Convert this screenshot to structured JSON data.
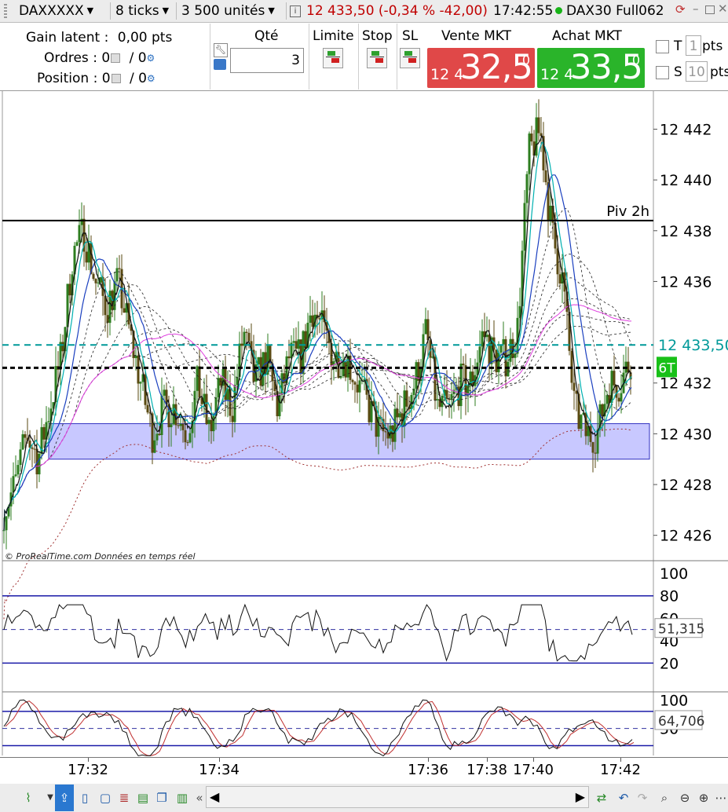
{
  "toolbar": {
    "instrument_select": "DAXXXXX",
    "ticks_select": "8 ticks",
    "units_select": "3 500 unités",
    "quote_text": "12 433,50 (-0,34 % -42,00)",
    "time": "17:42:55",
    "instrument_name": "DAX30 Full062",
    "colors": {
      "quote": "#c00000",
      "live_dot": "#18b418"
    }
  },
  "order_panel": {
    "gain_label": "Gain latent :",
    "gain_value": "0,00 pts",
    "orders_label": "Ordres : 0",
    "orders_value": "/ 0",
    "position_label": "Position : 0",
    "position_value": "/ 0",
    "qty_label": "Qté",
    "qty_value": "3",
    "limit_label": "Limite",
    "stop_label": "Stop",
    "sl_label": "SL",
    "sell_label": "Vente MKT",
    "sell_prefix": "12 4",
    "sell_big": "32,5",
    "sell_sup": "0",
    "buy_label": "Achat MKT",
    "buy_prefix": "12 4",
    "buy_big": "33,5",
    "buy_sup": "0",
    "t_label": "T",
    "t_value": "1",
    "t_unit": "pts",
    "s_label": "S",
    "s_value": "10",
    "s_unit": "pts",
    "colors": {
      "sell": "#e04848",
      "buy": "#2ab42a"
    }
  },
  "chart_data": {
    "type": "candlestick",
    "time_labels": [
      "17:32",
      "17:34",
      "17:36",
      "17:38",
      "17:40",
      "17:42"
    ],
    "price_axis": {
      "ticks": [
        "12 442",
        "12 440",
        "12 438",
        "12 436",
        "12 432",
        "12 430",
        "12 428",
        "12 426"
      ],
      "range": [
        12425,
        12443.5
      ]
    },
    "current_price_label": "12 433,50",
    "current_price": 12433.5,
    "position_tag": "6T",
    "pivot_label": "Piv 2h",
    "pivot_level": 12438.4,
    "dashed_level": 12432.6,
    "zone": {
      "low": 12429.0,
      "high": 12430.4
    },
    "close_path": [
      12427,
      12428,
      12430,
      12429,
      12431,
      12433,
      12437,
      12438,
      12436,
      12435,
      12436,
      12434,
      12432,
      12430,
      12431,
      12431,
      12430,
      12432,
      12430,
      12432,
      12431,
      12434,
      12432,
      12433,
      12431,
      12433,
      12433,
      12435,
      12434,
      12433,
      12433,
      12432,
      12431,
      12430,
      12430,
      12431,
      12432,
      12434,
      12431,
      12431,
      12432,
      12432,
      12434,
      12433,
      12433,
      12434,
      12441,
      12442,
      12438,
      12436,
      12431,
      12430,
      12430,
      12432,
      12432,
      12433
    ],
    "watermark": "© ProRealTime.com  Données en temps réel",
    "indicator1": {
      "ticks": [
        "100",
        "80",
        "60",
        "40",
        "20"
      ],
      "range": [
        0,
        105
      ],
      "bands": [
        20,
        80
      ],
      "value_label": "51,315",
      "value": 51.3
    },
    "indicator2": {
      "ticks": [
        "100",
        "50"
      ],
      "range": [
        0,
        110
      ],
      "bands": [
        20,
        80
      ],
      "value_label": "64,706",
      "value": 64.7
    },
    "colors": {
      "up": "#2d7d1f",
      "down": "#5a4a12",
      "fast_ma": "#00b0b0",
      "slow_ma": "#1a3fbf",
      "pink_ma": "#e040e0",
      "red_ma": "#a03030",
      "zone": "#c8c8ff",
      "price_line": "#009999"
    }
  }
}
